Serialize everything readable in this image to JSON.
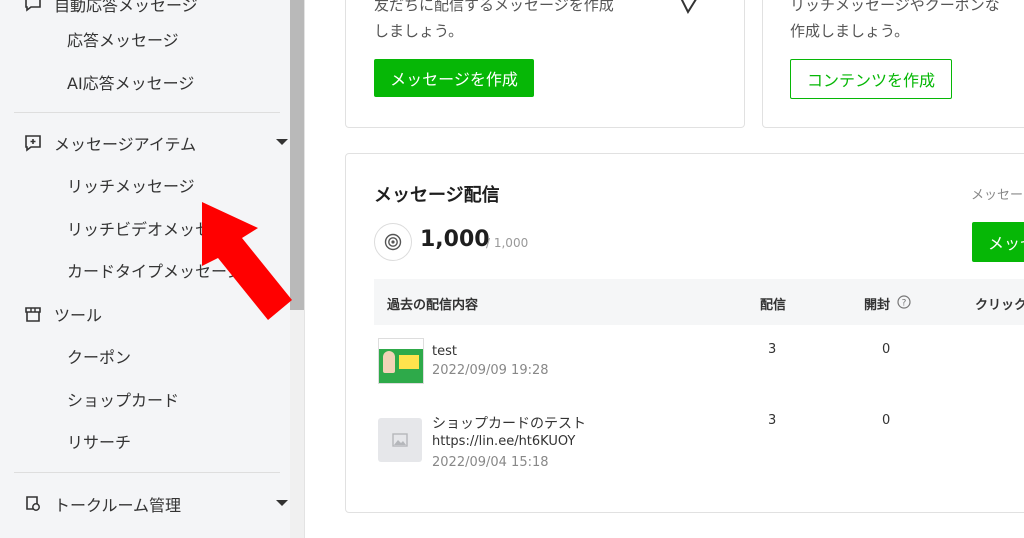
{
  "sidebar": {
    "top_partial_label": "自動応答メッセージ",
    "items": [
      {
        "label": "応答メッセージ"
      },
      {
        "label": "AI応答メッセージ"
      },
      {
        "label": "メッセージアイテム"
      },
      {
        "label": "リッチメッセージ"
      },
      {
        "label": "リッチビデオメッセージ"
      },
      {
        "label": "カードタイプメッセージ"
      },
      {
        "label": "ツール"
      },
      {
        "label": "クーポン"
      },
      {
        "label": "ショップカード"
      },
      {
        "label": "リサーチ"
      },
      {
        "label": "トークルーム管理"
      }
    ]
  },
  "cards": {
    "message_create": {
      "desc_line1": "友だちに配信するメッセージを作成",
      "desc_line2": "しましょう。",
      "button": "メッセージを作成"
    },
    "content_create": {
      "desc_line1": "リッチメッセージやクーポンな",
      "desc_line2": "作成しましょう。",
      "button": "コンテンツを作成"
    }
  },
  "delivery": {
    "title": "メッセージ配信",
    "right_link": "メッセー",
    "right_button": "メッセ",
    "count": "1,000",
    "limit": "/ 1,000",
    "columns": [
      "過去の配信内容",
      "配信",
      "開封",
      "クリック"
    ],
    "rows": [
      {
        "title": "test",
        "subtitle": "",
        "date": "2022/09/09 19:28",
        "sent": "3",
        "opened": "0"
      },
      {
        "title": "ショップカードのテスト",
        "subtitle": "https://lin.ee/ht6KUOY",
        "date": "2022/09/04 15:18",
        "sent": "3",
        "opened": "0"
      }
    ]
  },
  "colors": {
    "accent_green": "#06b706",
    "arrow_red": "#ff0000"
  }
}
